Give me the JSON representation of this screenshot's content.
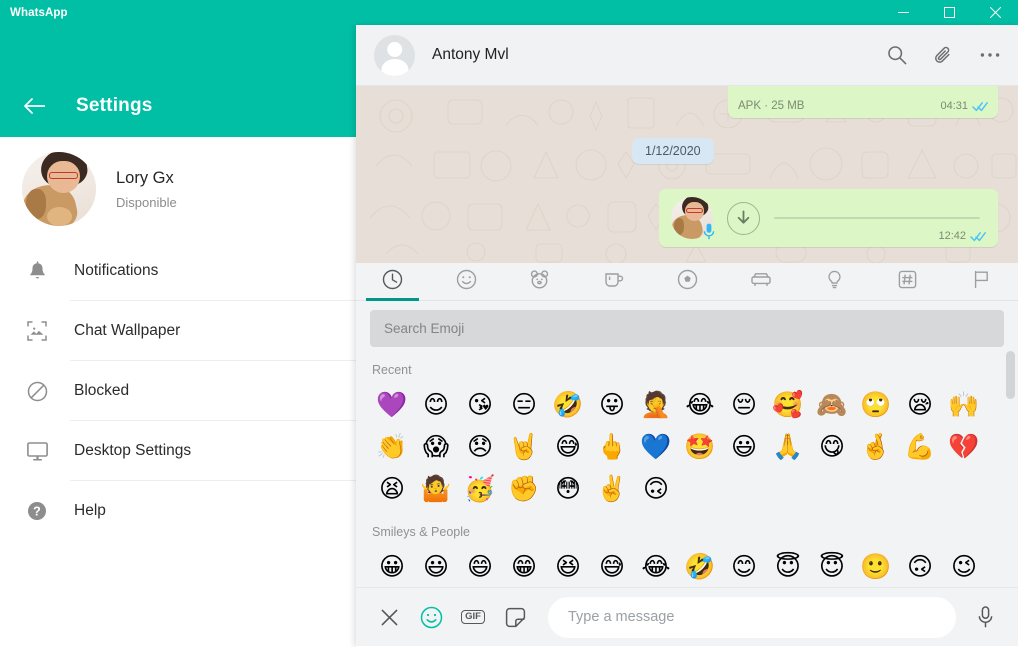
{
  "window": {
    "app_title": "WhatsApp",
    "controls": [
      {
        "name": "minimize",
        "label": "Minimize"
      },
      {
        "name": "maximize",
        "label": "Maximize"
      },
      {
        "name": "close",
        "label": "Close"
      }
    ],
    "accent_color": "#00bfa5"
  },
  "settings": {
    "back_label": "Back",
    "title": "Settings",
    "profile": {
      "name": "Lory Gx",
      "status": "Disponible",
      "avatar_icon": "profile-photo"
    },
    "menu": [
      {
        "label": "Notifications",
        "icon": "bell-icon"
      },
      {
        "label": "Chat Wallpaper",
        "icon": "image-icon"
      },
      {
        "label": "Blocked",
        "icon": "block-icon"
      },
      {
        "label": "Desktop Settings",
        "icon": "monitor-icon"
      },
      {
        "label": "Help",
        "icon": "help-icon"
      }
    ]
  },
  "chat": {
    "contact_name": "Antony Mvl",
    "header_actions": [
      {
        "name": "search-icon",
        "label": "Search"
      },
      {
        "name": "attach-icon",
        "label": "Attach"
      },
      {
        "name": "menu-icon",
        "label": "Menu"
      }
    ],
    "messages": {
      "file": {
        "meta": "APK · 25 MB",
        "time": "04:31",
        "status": "read"
      },
      "date_divider": "1/12/2020",
      "voice": {
        "time": "12:42",
        "status": "read"
      }
    }
  },
  "emoji_panel": {
    "tabs": [
      {
        "name": "recent-tab",
        "icon": "clock-icon",
        "active": true
      },
      {
        "name": "smileys-tab",
        "icon": "smiley-icon",
        "active": false
      },
      {
        "name": "animals-tab",
        "icon": "bear-icon",
        "active": false
      },
      {
        "name": "food-tab",
        "icon": "cup-icon",
        "active": false
      },
      {
        "name": "activity-tab",
        "icon": "ball-icon",
        "active": false
      },
      {
        "name": "travel-tab",
        "icon": "car-icon",
        "active": false
      },
      {
        "name": "objects-tab",
        "icon": "bulb-icon",
        "active": false
      },
      {
        "name": "symbols-tab",
        "icon": "hash-icon",
        "active": false
      },
      {
        "name": "flags-tab",
        "icon": "flag-icon",
        "active": false
      }
    ],
    "search_placeholder": "Search Emoji",
    "sections": [
      {
        "title": "Recent",
        "emoji": [
          "💜",
          "😊",
          "😘",
          "😑",
          "🤣",
          "😛",
          "🤦",
          "😂",
          "😔",
          "🥰",
          "🙈",
          "🙄",
          "😪",
          "🙌",
          "👏",
          "😱",
          "😞",
          "🤘",
          "😅",
          "🖕",
          "💙",
          "🤩",
          "😃",
          "🙏",
          "😋",
          "🤞",
          "💪",
          "💔",
          "😫",
          "🤷",
          "🥳",
          "✊",
          "😳",
          "✌️",
          "🙃"
        ]
      },
      {
        "title": "Smileys & People",
        "emoji": [
          "😀",
          "😃",
          "😄",
          "😁",
          "😆",
          "😅",
          "😂",
          "🤣",
          "😊",
          "😇",
          "😇",
          "🙂",
          "🙃",
          "😉"
        ]
      }
    ]
  },
  "composer": {
    "close_label": "Close",
    "emoji_label": "Emoji",
    "gif_label": "GIF",
    "sticker_label": "Sticker",
    "input_placeholder": "Type a message",
    "mic_label": "Voice message"
  }
}
